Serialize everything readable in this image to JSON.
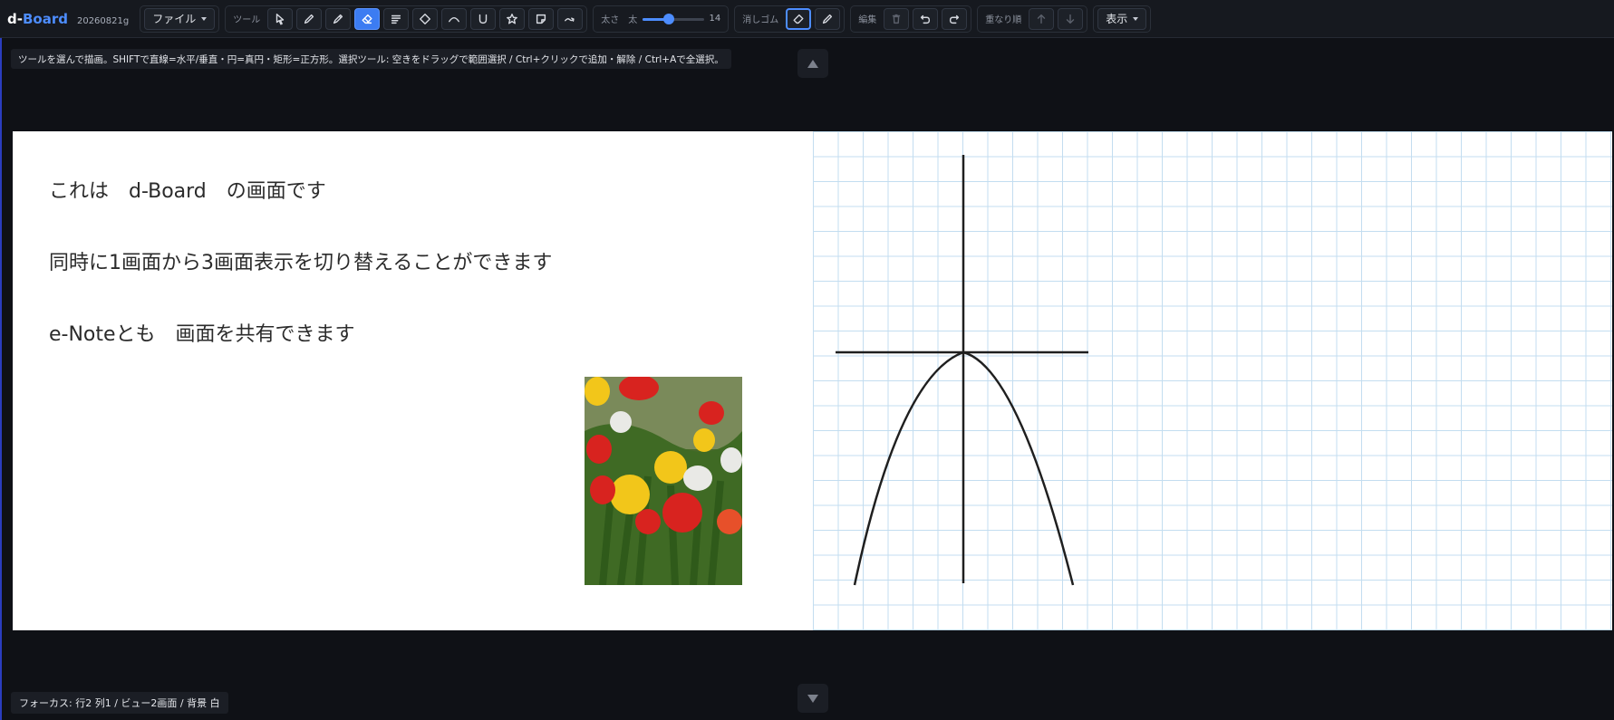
{
  "app": {
    "brand_d": "d-",
    "brand_name": "Board",
    "version": "20260821g"
  },
  "toolbar": {
    "file_label": "ファイル",
    "tools_label": "ツール",
    "width_label": "太さ",
    "width_sub": "太",
    "width_value": "14",
    "width_fraction": 0.42,
    "eraser_label": "消しゴム",
    "edit_label": "編集",
    "order_label": "重なり順",
    "view_label": "表示"
  },
  "hint": "ツールを選んで描画。SHIFTで直線=水平/垂直・円=真円・矩形=正方形。選択ツール: 空きをドラッグで範囲選択 / Ctrl+クリックで追加・解除 / Ctrl+Aで全選択。",
  "left_page": {
    "lines": [
      "これは　d-Board　の画面です",
      "同時に1画面から3画面表示を切り替えることができます",
      "e-Noteとも　画面を共有できます"
    ]
  },
  "status": "フォーカス: 行2 列1 / ビュー2画面 / 背景 白",
  "colors": {
    "accent": "#3c7cf2",
    "grid": "#c3ddf0",
    "background": "#0f1116"
  }
}
